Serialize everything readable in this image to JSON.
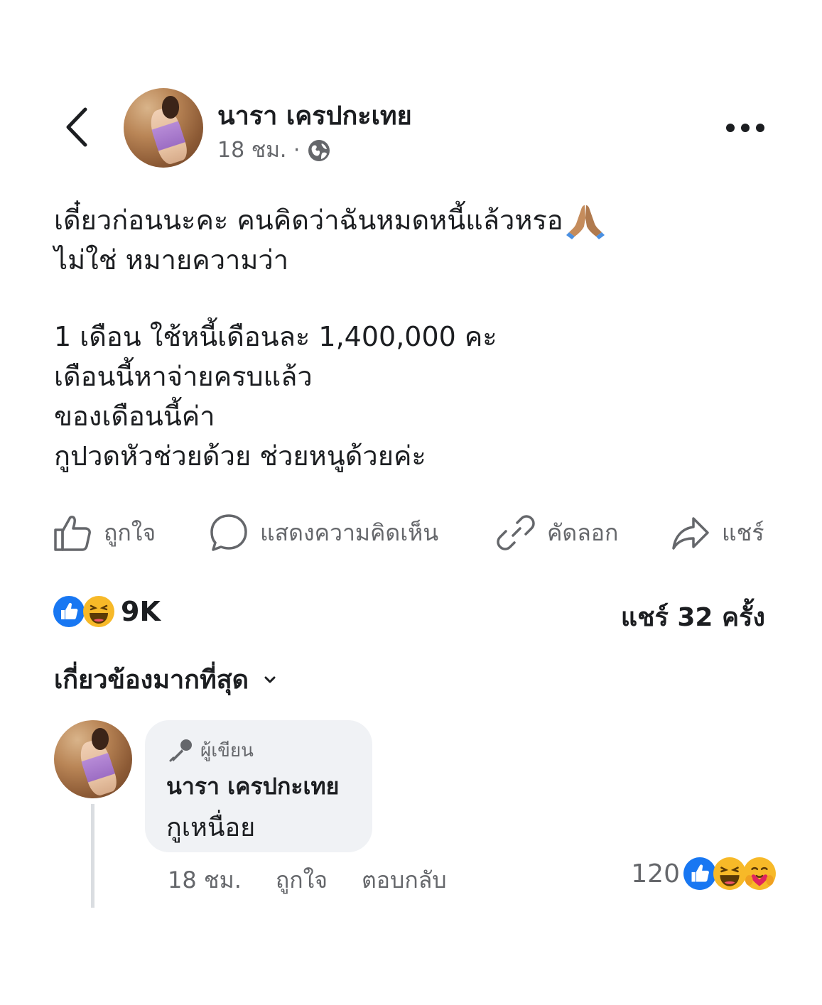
{
  "post": {
    "author": "นารา เครปกะเทย",
    "time": "18 ชม. ·",
    "body_lines": [
      "เดี๋ยวก่อนนะคะ คนคิดว่าฉันหมดหนี้แล้วหรอ",
      "ไม่ใช่  หมายความว่า",
      "",
      "1 เดือน ใช้หนี้เดือนละ 1,400,000 คะ",
      "เดือนนี้หาจ่ายครบแล้ว",
      "ของเดือนนี้ค่า",
      "กูปวดหัวช่วยด้วย  ช่วยหนูด้วยค่ะ"
    ]
  },
  "actions": {
    "like": "ถูกใจ",
    "comment": "แสดงความคิดเห็น",
    "copy": "คัดลอก",
    "share": "แชร์"
  },
  "stats": {
    "reactions": "9K",
    "shares": "แชร์ 32 ครั้ง"
  },
  "sort": {
    "label": "เกี่ยวข้องมากที่สุด"
  },
  "comment": {
    "badge": "ผู้เขียน",
    "author": "นารา เครปกะเทย",
    "text": "กูเหนื่อย",
    "time": "18 ชม.",
    "like": "ถูกใจ",
    "reply": "ตอบกลับ",
    "reaction_count": "120"
  },
  "colors": {
    "fb_blue": "#1877f2",
    "secondary_text": "#65676b",
    "bubble_bg": "#f0f2f5",
    "haha_yellow": "#f7b928"
  }
}
